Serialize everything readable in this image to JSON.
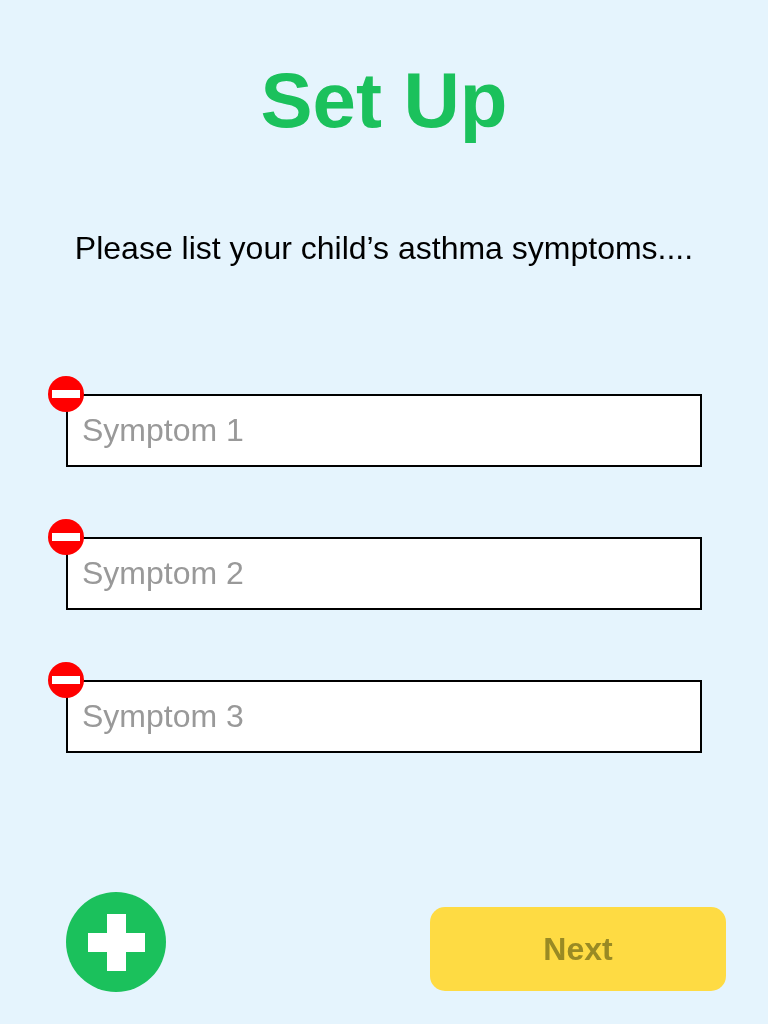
{
  "title": "Set Up",
  "prompt": "Please list your child’s asthma symptoms....",
  "symptoms": [
    {
      "placeholder": "Symptom 1"
    },
    {
      "placeholder": "Symptom 2"
    },
    {
      "placeholder": "Symptom 3"
    }
  ],
  "next_button": {
    "label": "Next"
  }
}
